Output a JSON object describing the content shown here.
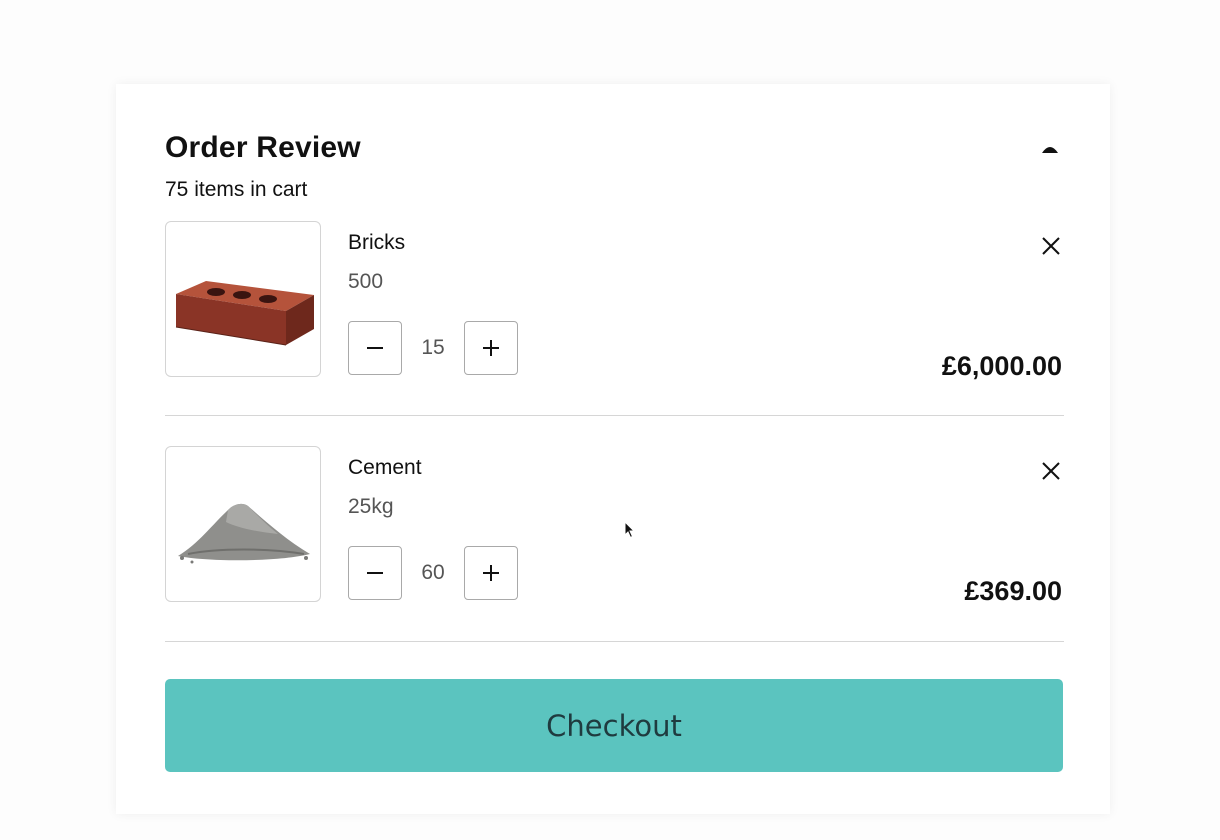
{
  "order_review": {
    "title": "Order Review",
    "item_count_text": "75 items in cart",
    "collapse_icon": "chevron-up-icon"
  },
  "items": [
    {
      "name": "Bricks",
      "variant": "500",
      "quantity": "15",
      "price": "£6,000.00",
      "image_icon": "brick-image"
    },
    {
      "name": "Cement",
      "variant": "25kg",
      "quantity": "60",
      "price": "£369.00",
      "image_icon": "cement-pile-image"
    }
  ],
  "checkout": {
    "label": "Checkout",
    "color": "#5bc4bf"
  },
  "colors": {
    "accent": "#5bc4bf",
    "text": "#111111",
    "muted": "#555555",
    "border": "#d4d4d4"
  }
}
